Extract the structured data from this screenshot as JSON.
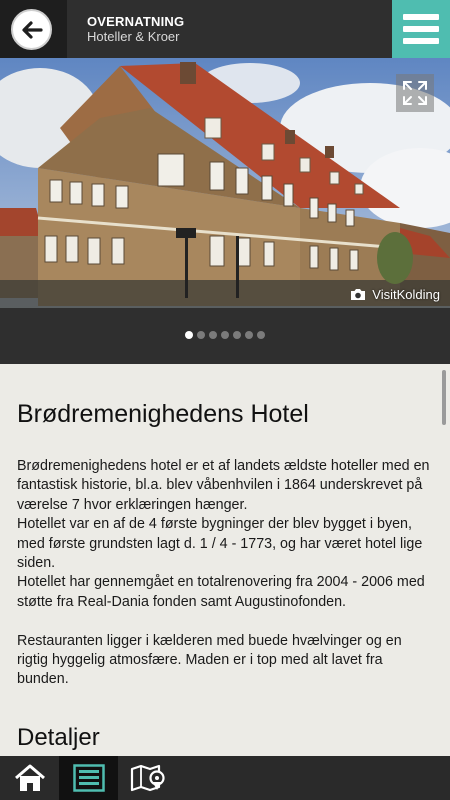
{
  "header": {
    "title": "OVERNATNING",
    "subtitle": "Hoteller & Kroer"
  },
  "hero": {
    "photo_credit": "VisitKolding",
    "slides": 7,
    "active_slide": 1
  },
  "content": {
    "title": "Brødremenighedens Hotel",
    "description": [
      "Brødremenighedens hotel er et af landets ældste hoteller med en fantastisk historie, bl.a. blev våbenhvilen i 1864 underskrevet på værelse 7 hvor erklæringen hænger.",
      "Hotellet var en af de 4 første bygninger der blev bygget i byen, med første grundsten lagt d. 1 / 4 - 1773, og har været hotel lige siden.",
      "Hotellet har gennemgået en totalrenovering fra 2004 - 2006 med støtte fra Real-Dania fonden samt Augustinofonden.",
      "Restauranten ligger i kælderen med buede hvælvinger og en rigtig hyggelig atmosfære. Maden er i top med alt lavet fra bunden."
    ],
    "details_heading": "Detaljer"
  },
  "colors": {
    "header_bg": "#2f2f2f",
    "accent": "#4fbdb0",
    "content_bg": "#ecebe6",
    "nav_bg": "#2a2a2a"
  }
}
